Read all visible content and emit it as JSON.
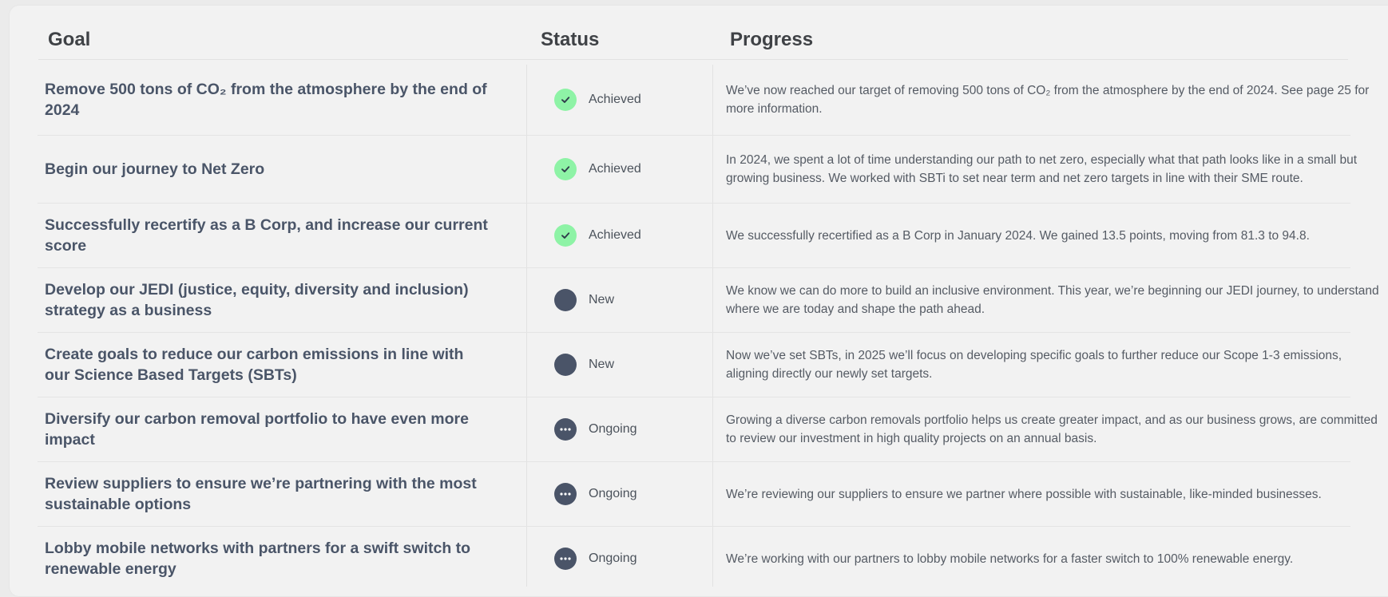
{
  "header": {
    "goal": "Goal",
    "status": "Status",
    "progress": "Progress"
  },
  "colors": {
    "achieved": "#8ef3a6",
    "new": "#4a5468",
    "ongoing": "#4a5468"
  },
  "rows": [
    {
      "goal": "Remove 500 tons of CO₂ from the atmosphere by the end of 2024",
      "status": "Achieved",
      "status_icon": "check-icon",
      "progress": "We’ve now reached our target of removing 500 tons of CO₂ from the atmosphere by the end of 2024. See page 25 for more information."
    },
    {
      "goal": "Begin our journey to Net Zero",
      "status": "Achieved",
      "status_icon": "check-icon",
      "progress": "In 2024, we spent a lot of time understanding our path to net zero, especially what that path looks like in a small but growing business. We worked with SBTi to set near term and net zero targets in line with their SME route."
    },
    {
      "goal": "Successfully recertify as a B Corp, and increase our current score",
      "status": "Achieved",
      "status_icon": "check-icon",
      "progress": "We successfully recertified as a B Corp in January 2024. We gained 13.5 points, moving from 81.3 to 94.8."
    },
    {
      "goal": "Develop our JEDI (justice, equity, diversity and inclusion) strategy as a business",
      "status": "New",
      "status_icon": "filled-circle-icon",
      "progress": "We know we can do more to build an inclusive environment. This year, we’re beginning our JEDI journey, to understand where we are today and shape the path ahead."
    },
    {
      "goal": "Create goals to reduce our carbon emissions in line with our Science Based Targets (SBTs)",
      "status": "New",
      "status_icon": "filled-circle-icon",
      "progress": "Now we’ve set SBTs, in 2025 we’ll focus on developing specific goals to further reduce our Scope 1-3 emissions, aligning directly our newly set targets."
    },
    {
      "goal": "Diversify our carbon removal portfolio to have even more impact",
      "status": "Ongoing",
      "status_icon": "ellipsis-icon",
      "progress": "Growing a diverse carbon removals portfolio helps us create greater impact, and as our business grows, are committed to review our investment in high quality projects on an annual basis."
    },
    {
      "goal": "Review suppliers to ensure we’re partnering with the most sustainable options",
      "status": "Ongoing",
      "status_icon": "ellipsis-icon",
      "progress": "We’re reviewing our suppliers to ensure we partner where possible with sustainable, like-minded businesses."
    },
    {
      "goal": "Lobby mobile networks with partners for a swift switch to renewable energy",
      "status": "Ongoing",
      "status_icon": "ellipsis-icon",
      "progress": "We’re working with our partners to lobby mobile networks for a faster switch to 100% renewable energy."
    }
  ]
}
